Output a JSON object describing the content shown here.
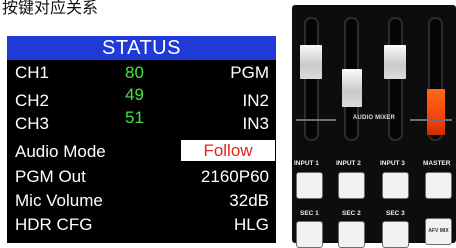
{
  "top_text": "按键对应关系",
  "status": {
    "title": "STATUS",
    "rows": [
      {
        "label": "CH1",
        "level": "80",
        "value": "PGM"
      },
      {
        "label": "CH2",
        "level": "49",
        "value": "IN2"
      },
      {
        "label": "CH3",
        "level": "51",
        "value": "IN3"
      },
      {
        "label": "Audio Mode",
        "value": "Follow"
      },
      {
        "label": "PGM Out",
        "value": "2160P60"
      },
      {
        "label": "Mic Volume",
        "value": "32dB"
      },
      {
        "label": "HDR  CFG",
        "value": "HLG"
      }
    ]
  },
  "mixer": {
    "title": "AUDIO MIXER",
    "input_buttons": [
      "INPUT 1",
      "INPUT 2",
      "INPUT 3",
      "MASTER"
    ],
    "sec_buttons": [
      "SEC 1",
      "SEC 2",
      "SEC 3"
    ],
    "afv_button": "AFV MIX"
  },
  "colors": {
    "lcd_header": "#1f3ad6",
    "level_text": "#43e243",
    "follow_text": "#e0251c",
    "master_fader": "#f0400a"
  }
}
